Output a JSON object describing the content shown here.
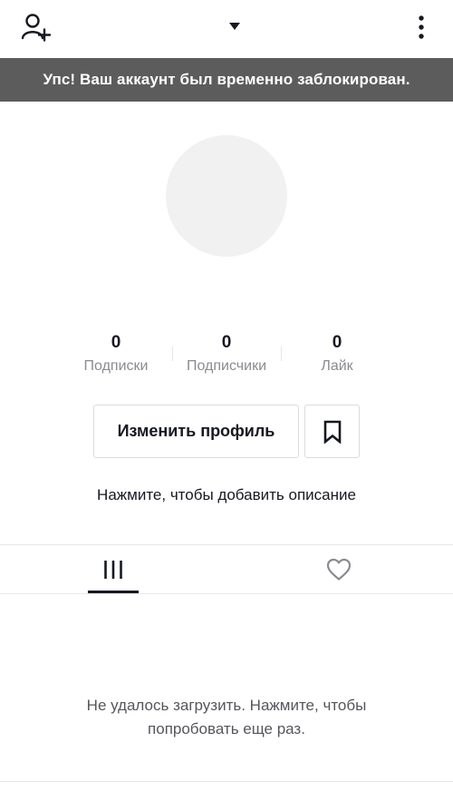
{
  "banner": {
    "text": "Упс! Ваш аккаунт был временно заблокирован."
  },
  "stats": [
    {
      "value": "0",
      "label": "Подписки"
    },
    {
      "value": "0",
      "label": "Подписчики"
    },
    {
      "value": "0",
      "label": "Лайк"
    }
  ],
  "actions": {
    "edit_profile_label": "Изменить профиль"
  },
  "bio": {
    "placeholder": "Нажмите, чтобы добавить описание"
  },
  "error": {
    "line1": "Не удалось загрузить. Нажмите, чтобы",
    "line2": "попробовать еще раз."
  },
  "icons": {
    "top_left": "add-user-icon",
    "top_center": "dropdown-triangle-icon",
    "top_right": "more-vertical-icon",
    "bookmark": "bookmark-icon",
    "tab_videos": "grid-lines-icon",
    "tab_liked": "heart-outline-icon"
  },
  "colors": {
    "banner_bg": "#5c5c5c",
    "text_primary": "#161823",
    "text_secondary": "#8a8b91"
  }
}
